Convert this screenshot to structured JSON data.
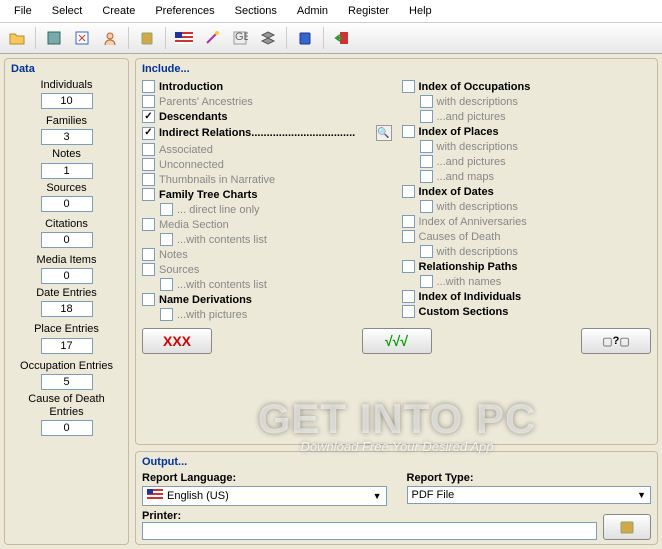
{
  "menu": [
    "File",
    "Select",
    "Create",
    "Preferences",
    "Sections",
    "Admin",
    "Register",
    "Help"
  ],
  "data_panel": {
    "title": "Data",
    "items": [
      {
        "label": "Individuals",
        "value": "10"
      },
      {
        "label": "Families",
        "value": "3"
      },
      {
        "label": "Notes",
        "value": "1"
      },
      {
        "label": "Sources",
        "value": "0"
      },
      {
        "label": "Citations",
        "value": "0"
      },
      {
        "label": "Media Items",
        "value": "0"
      },
      {
        "label": "Date Entries",
        "value": "18"
      },
      {
        "label": "Place Entries",
        "value": "17"
      },
      {
        "label": "Occupation Entries",
        "value": "5"
      },
      {
        "label": "Cause of Death\nEntries",
        "value": "0"
      }
    ]
  },
  "include_panel": {
    "title": "Include...",
    "col1": [
      {
        "label": "Introduction",
        "checked": false,
        "enabled": true,
        "indent": 0
      },
      {
        "label": "Parents' Ancestries",
        "checked": false,
        "enabled": false,
        "indent": 0
      },
      {
        "label": "Descendants",
        "checked": true,
        "enabled": true,
        "indent": 0
      },
      {
        "label": "Indirect Relations..................................",
        "checked": true,
        "enabled": true,
        "indent": 0,
        "magnify": true
      },
      {
        "label": "Associated",
        "checked": false,
        "enabled": false,
        "indent": 0
      },
      {
        "label": "Unconnected",
        "checked": false,
        "enabled": false,
        "indent": 0
      },
      {
        "label": "Thumbnails in Narrative",
        "checked": false,
        "enabled": false,
        "indent": 0
      },
      {
        "label": "Family Tree Charts",
        "checked": false,
        "enabled": true,
        "indent": 0
      },
      {
        "label": "... direct line only",
        "checked": false,
        "enabled": false,
        "indent": 1
      },
      {
        "label": "Media Section",
        "checked": false,
        "enabled": false,
        "indent": 0
      },
      {
        "label": "...with contents list",
        "checked": false,
        "enabled": false,
        "indent": 1
      },
      {
        "label": "Notes",
        "checked": false,
        "enabled": false,
        "indent": 0
      },
      {
        "label": "Sources",
        "checked": false,
        "enabled": false,
        "indent": 0
      },
      {
        "label": "...with contents list",
        "checked": false,
        "enabled": false,
        "indent": 1
      },
      {
        "label": "Name Derivations",
        "checked": false,
        "enabled": true,
        "indent": 0
      },
      {
        "label": "...with pictures",
        "checked": false,
        "enabled": false,
        "indent": 1
      }
    ],
    "col2": [
      {
        "label": "Index of Occupations",
        "checked": false,
        "enabled": true,
        "indent": 0
      },
      {
        "label": "with descriptions",
        "checked": false,
        "enabled": false,
        "indent": 1
      },
      {
        "label": "...and pictures",
        "checked": false,
        "enabled": false,
        "indent": 1
      },
      {
        "label": "Index of Places",
        "checked": false,
        "enabled": true,
        "indent": 0
      },
      {
        "label": "with descriptions",
        "checked": false,
        "enabled": false,
        "indent": 1
      },
      {
        "label": "...and pictures",
        "checked": false,
        "enabled": false,
        "indent": 1
      },
      {
        "label": "...and maps",
        "checked": false,
        "enabled": false,
        "indent": 1
      },
      {
        "label": "Index of Dates",
        "checked": false,
        "enabled": true,
        "indent": 0
      },
      {
        "label": "with descriptions",
        "checked": false,
        "enabled": false,
        "indent": 1
      },
      {
        "label": "Index of Anniversaries",
        "checked": false,
        "enabled": false,
        "indent": 0
      },
      {
        "label": "Causes of Death",
        "checked": false,
        "enabled": false,
        "indent": 0
      },
      {
        "label": "with descriptions",
        "checked": false,
        "enabled": false,
        "indent": 1
      },
      {
        "label": "Relationship Paths",
        "checked": false,
        "enabled": true,
        "indent": 0
      },
      {
        "label": "...with names",
        "checked": false,
        "enabled": false,
        "indent": 1
      },
      {
        "label": "Index of Individuals",
        "checked": false,
        "enabled": true,
        "indent": 0
      },
      {
        "label": "Custom Sections",
        "checked": false,
        "enabled": true,
        "indent": 0
      }
    ],
    "buttons": {
      "clear": "XXX",
      "all": "√√√",
      "help": "?"
    }
  },
  "output_panel": {
    "title": "Output...",
    "lang_label": "Report Language:",
    "lang_value": "English (US)",
    "type_label": "Report Type:",
    "type_value": "PDF File",
    "printer_label": "Printer:",
    "printer_value": ""
  },
  "watermark": {
    "big": "GET INTO PC",
    "sub": "Download Free Your Desired App"
  }
}
